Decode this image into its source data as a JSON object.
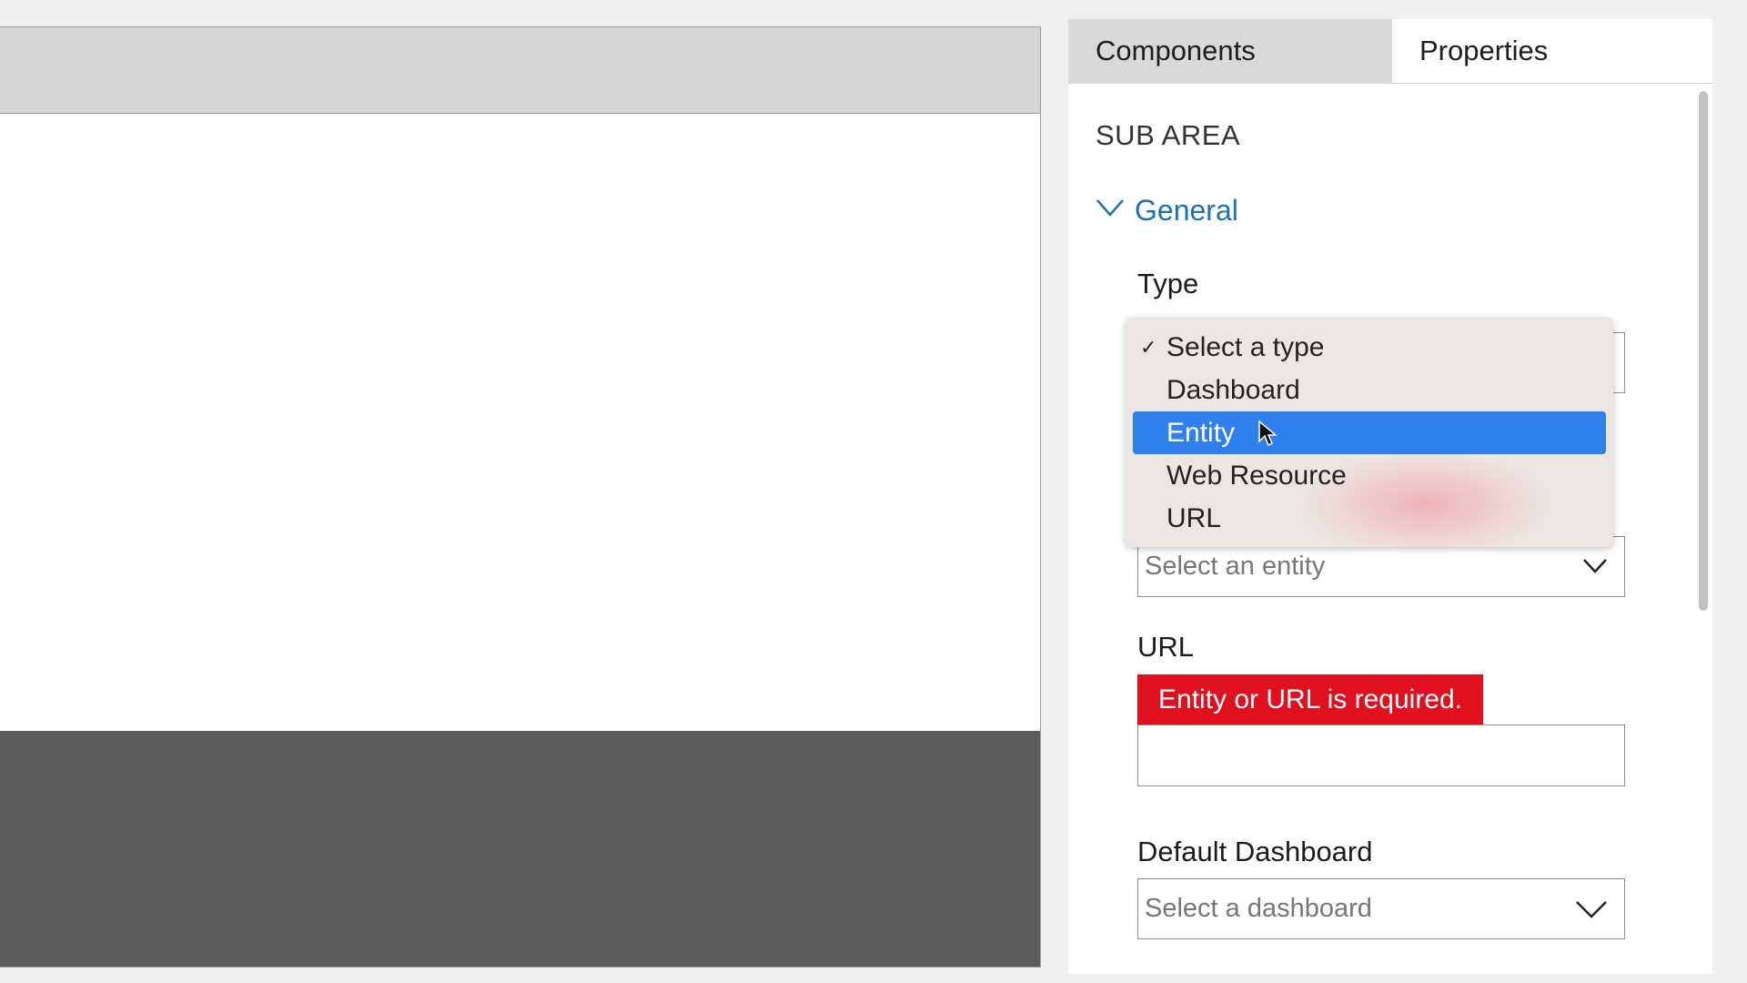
{
  "tabs": {
    "components": "Components",
    "properties": "Properties"
  },
  "section": {
    "title": "SUB AREA"
  },
  "general": {
    "label": "General"
  },
  "type": {
    "label": "Type",
    "options": [
      {
        "label": "Select a type",
        "checked": true
      },
      {
        "label": "Dashboard"
      },
      {
        "label": "Entity",
        "highlighted": true
      },
      {
        "label": "Web Resource"
      },
      {
        "label": "URL"
      }
    ],
    "check_mark": "✓"
  },
  "entity": {
    "placeholder": "Select an entity"
  },
  "url": {
    "label": "URL",
    "error": "Entity or URL is required.",
    "value": ""
  },
  "default_dashboard": {
    "label": "Default Dashboard",
    "placeholder": "Select a dashboard"
  },
  "colors": {
    "accent": "#1a73b8",
    "error": "#e1101f",
    "highlight": "#2f80ed"
  },
  "icons": {
    "expand": "chevron-down-icon",
    "select": "chevron-down-icon",
    "pointer": "mouse-cursor-icon"
  }
}
